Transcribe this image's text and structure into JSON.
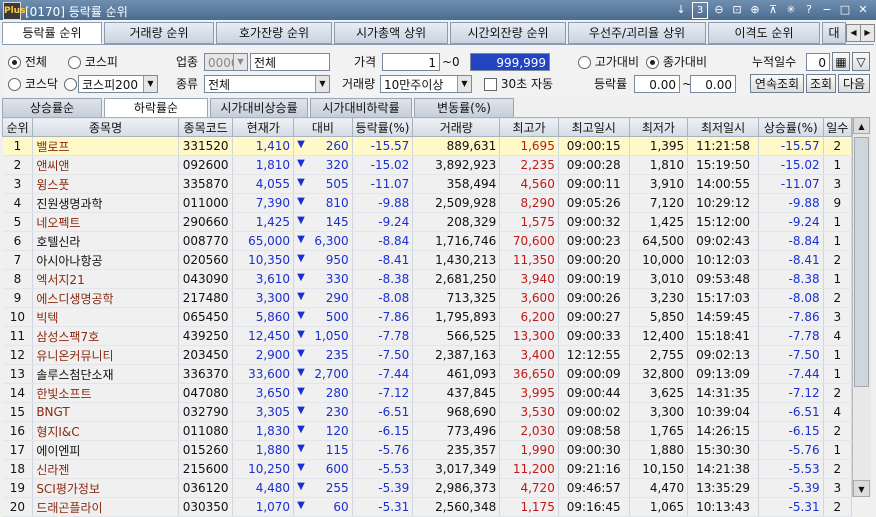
{
  "window": {
    "title": "[0170] 등락률 순위",
    "logo": "Plus",
    "page_num": "3"
  },
  "top_tabs": [
    "등락률 순위",
    "거래량 순위",
    "호가잔량 순위",
    "시가총액 상위",
    "시간외잔량 순위",
    "우선주/괴리율 상위",
    "이격도 순위",
    "대량"
  ],
  "filters": {
    "market_all": "전체",
    "kospi": "코스피",
    "kosdaq": "코스닥",
    "kospi200": "코스피200",
    "industry_label": "업종",
    "industry_code": "0000",
    "industry_value": "전체",
    "type_label": "종류",
    "type_value": "전체",
    "price_label": "가격",
    "price_from": "1",
    "price_sep": "~0",
    "price_to": "999,999",
    "volume_label": "거래량",
    "volume_value": "10만주이상",
    "auto30": "30초 자동",
    "vs_high": "고가대비",
    "vs_close": "종가대비",
    "rate_label": "등락률",
    "rate_from": "0.00",
    "rate_sep": "~",
    "rate_to": "0.00",
    "cum_days_label": "누적일수",
    "cum_days": "0",
    "btn_consecutive": "연속조회",
    "btn_query": "조회",
    "btn_next": "다음"
  },
  "sub_tabs": [
    "상승률순",
    "하락률순",
    "시가대비상승률",
    "시가대비하락률",
    "변동률(%)"
  ],
  "columns": [
    "순위",
    "종목명",
    "종목코드",
    "현재가",
    "대비",
    "등락률(%)",
    "거래량",
    "최고가",
    "최고일시",
    "최저가",
    "최저일시",
    "상승률(%)",
    "일수"
  ],
  "rows": [
    {
      "rank": "1",
      "name": "밸로프",
      "code": "331520",
      "price": "1,410",
      "change": "260",
      "rate": "-15.57",
      "volume": "889,631",
      "high": "1,695",
      "high_time": "09:00:15",
      "low": "1,395",
      "low_time": "11:21:58",
      "up_rate": "-15.57",
      "days": "2",
      "brown": true
    },
    {
      "rank": "2",
      "name": "앤씨앤",
      "code": "092600",
      "price": "1,810",
      "change": "320",
      "rate": "-15.02",
      "volume": "3,892,923",
      "high": "2,235",
      "high_time": "09:00:28",
      "low": "1,810",
      "low_time": "15:19:50",
      "up_rate": "-15.02",
      "days": "1",
      "brown": true
    },
    {
      "rank": "3",
      "name": "윙스풋",
      "code": "335870",
      "price": "4,055",
      "change": "505",
      "rate": "-11.07",
      "volume": "358,494",
      "high": "4,560",
      "high_time": "09:00:11",
      "low": "3,910",
      "low_time": "14:00:55",
      "up_rate": "-11.07",
      "days": "3",
      "brown": true
    },
    {
      "rank": "4",
      "name": "진원생명과학",
      "code": "011000",
      "price": "7,390",
      "change": "810",
      "rate": "-9.88",
      "volume": "2,509,928",
      "high": "8,290",
      "high_time": "09:05:26",
      "low": "7,120",
      "low_time": "10:29:12",
      "up_rate": "-9.88",
      "days": "9",
      "brown": false
    },
    {
      "rank": "5",
      "name": "네오펙트",
      "code": "290660",
      "price": "1,425",
      "change": "145",
      "rate": "-9.24",
      "volume": "208,329",
      "high": "1,575",
      "high_time": "09:00:32",
      "low": "1,425",
      "low_time": "15:12:00",
      "up_rate": "-9.24",
      "days": "1",
      "brown": true
    },
    {
      "rank": "6",
      "name": "호텔신라",
      "code": "008770",
      "price": "65,000",
      "change": "6,300",
      "rate": "-8.84",
      "volume": "1,716,746",
      "high": "70,600",
      "high_time": "09:00:23",
      "low": "64,500",
      "low_time": "09:02:43",
      "up_rate": "-8.84",
      "days": "1",
      "brown": false
    },
    {
      "rank": "7",
      "name": "아시아나항공",
      "code": "020560",
      "price": "10,350",
      "change": "950",
      "rate": "-8.41",
      "volume": "1,430,213",
      "high": "11,350",
      "high_time": "09:00:20",
      "low": "10,000",
      "low_time": "10:12:03",
      "up_rate": "-8.41",
      "days": "2",
      "brown": false
    },
    {
      "rank": "8",
      "name": "엑서지21",
      "code": "043090",
      "price": "3,610",
      "change": "330",
      "rate": "-8.38",
      "volume": "2,681,250",
      "high": "3,940",
      "high_time": "09:00:19",
      "low": "3,010",
      "low_time": "09:53:48",
      "up_rate": "-8.38",
      "days": "1",
      "brown": true
    },
    {
      "rank": "9",
      "name": "에스디생명공학",
      "code": "217480",
      "price": "3,300",
      "change": "290",
      "rate": "-8.08",
      "volume": "713,325",
      "high": "3,600",
      "high_time": "09:00:26",
      "low": "3,230",
      "low_time": "15:17:03",
      "up_rate": "-8.08",
      "days": "2",
      "brown": true
    },
    {
      "rank": "10",
      "name": "빅텍",
      "code": "065450",
      "price": "5,860",
      "change": "500",
      "rate": "-7.86",
      "volume": "1,795,893",
      "high": "6,200",
      "high_time": "09:00:27",
      "low": "5,850",
      "low_time": "14:59:45",
      "up_rate": "-7.86",
      "days": "3",
      "brown": true
    },
    {
      "rank": "11",
      "name": "삼성스팩7호",
      "code": "439250",
      "price": "12,450",
      "change": "1,050",
      "rate": "-7.78",
      "volume": "566,525",
      "high": "13,300",
      "high_time": "09:00:33",
      "low": "12,400",
      "low_time": "15:18:41",
      "up_rate": "-7.78",
      "days": "4",
      "brown": true
    },
    {
      "rank": "12",
      "name": "유니온커뮤니티",
      "code": "203450",
      "price": "2,900",
      "change": "235",
      "rate": "-7.50",
      "volume": "2,387,163",
      "high": "3,400",
      "high_time": "12:12:55",
      "low": "2,755",
      "low_time": "09:02:13",
      "up_rate": "-7.50",
      "days": "1",
      "brown": true
    },
    {
      "rank": "13",
      "name": "솔루스첨단소재",
      "code": "336370",
      "price": "33,600",
      "change": "2,700",
      "rate": "-7.44",
      "volume": "461,093",
      "high": "36,650",
      "high_time": "09:00:09",
      "low": "32,800",
      "low_time": "09:13:09",
      "up_rate": "-7.44",
      "days": "1",
      "brown": false
    },
    {
      "rank": "14",
      "name": "한빛소프트",
      "code": "047080",
      "price": "3,650",
      "change": "280",
      "rate": "-7.12",
      "volume": "437,845",
      "high": "3,995",
      "high_time": "09:00:44",
      "low": "3,625",
      "low_time": "14:31:35",
      "up_rate": "-7.12",
      "days": "2",
      "brown": true
    },
    {
      "rank": "15",
      "name": "BNGT",
      "code": "032790",
      "price": "3,305",
      "change": "230",
      "rate": "-6.51",
      "volume": "968,690",
      "high": "3,530",
      "high_time": "09:00:02",
      "low": "3,300",
      "low_time": "10:39:04",
      "up_rate": "-6.51",
      "days": "4",
      "brown": true
    },
    {
      "rank": "16",
      "name": "형지I&C",
      "code": "011080",
      "price": "1,830",
      "change": "120",
      "rate": "-6.15",
      "volume": "773,496",
      "high": "2,030",
      "high_time": "09:08:58",
      "low": "1,765",
      "low_time": "14:26:15",
      "up_rate": "-6.15",
      "days": "2",
      "brown": true
    },
    {
      "rank": "17",
      "name": "에이엔피",
      "code": "015260",
      "price": "1,880",
      "change": "115",
      "rate": "-5.76",
      "volume": "235,357",
      "high": "1,990",
      "high_time": "09:00:30",
      "low": "1,880",
      "low_time": "15:30:30",
      "up_rate": "-5.76",
      "days": "1",
      "brown": false
    },
    {
      "rank": "18",
      "name": "신라젠",
      "code": "215600",
      "price": "10,250",
      "change": "600",
      "rate": "-5.53",
      "volume": "3,017,349",
      "high": "11,200",
      "high_time": "09:21:16",
      "low": "10,150",
      "low_time": "14:21:38",
      "up_rate": "-5.53",
      "days": "2",
      "brown": true
    },
    {
      "rank": "19",
      "name": "SCI평가정보",
      "code": "036120",
      "price": "4,480",
      "change": "255",
      "rate": "-5.39",
      "volume": "2,986,373",
      "high": "4,720",
      "high_time": "09:46:57",
      "low": "4,470",
      "low_time": "13:35:29",
      "up_rate": "-5.39",
      "days": "3",
      "brown": true
    },
    {
      "rank": "20",
      "name": "드래곤플라이",
      "code": "030350",
      "price": "1,070",
      "change": "60",
      "rate": "-5.31",
      "volume": "2,560,348",
      "high": "1,175",
      "high_time": "09:16:45",
      "low": "1,065",
      "low_time": "10:13:43",
      "up_rate": "-5.31",
      "days": "2",
      "brown": true
    }
  ]
}
